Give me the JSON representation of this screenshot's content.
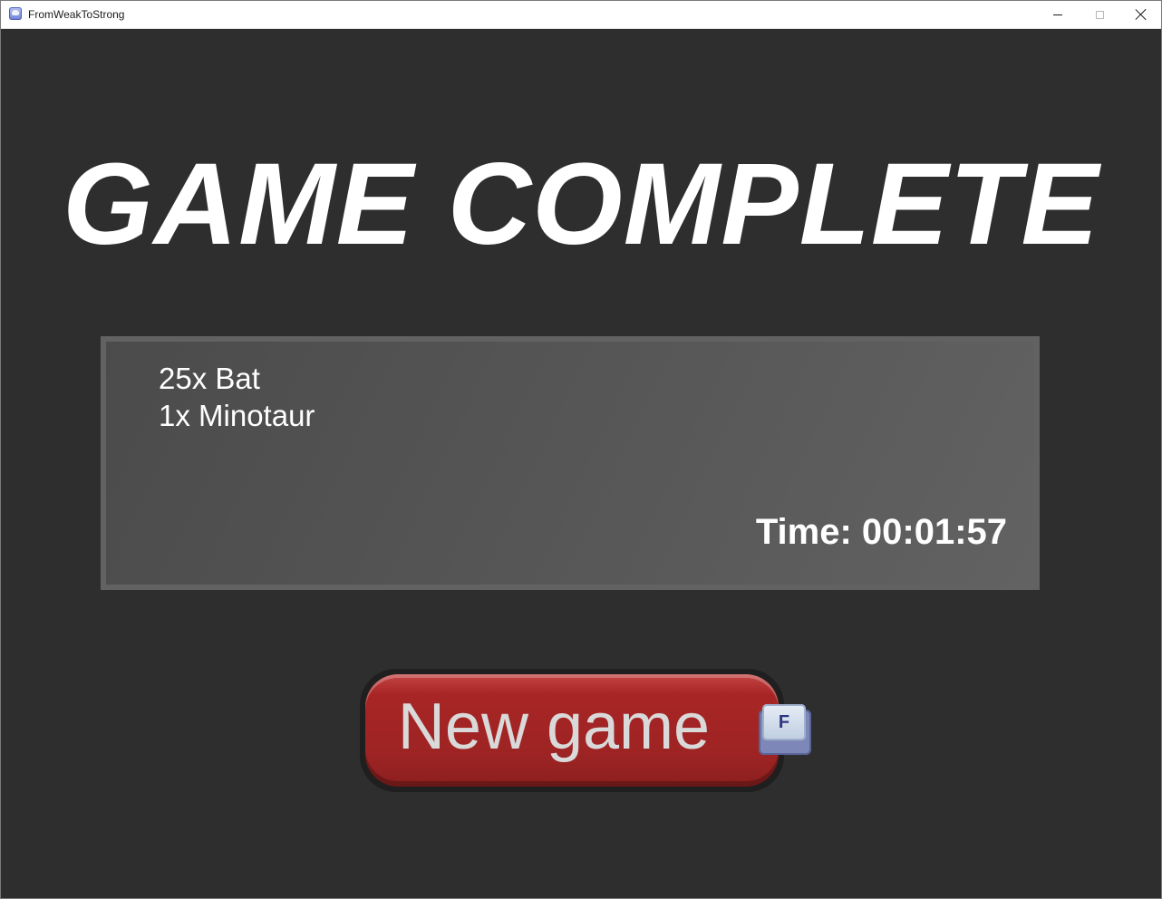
{
  "window": {
    "title": "FromWeakToStrong",
    "icon": "app-icon"
  },
  "screen": {
    "heading": "GAME COMPLETE"
  },
  "stats": {
    "kills": [
      {
        "label": "25x Bat"
      },
      {
        "label": "1x Minotaur"
      }
    ],
    "time_label": "Time: 00:01:57"
  },
  "actions": {
    "new_game_label": "New game",
    "new_game_key": "F"
  },
  "colors": {
    "background": "#2e2e2e",
    "panel": "#555555",
    "button_red": "#9e2424"
  }
}
